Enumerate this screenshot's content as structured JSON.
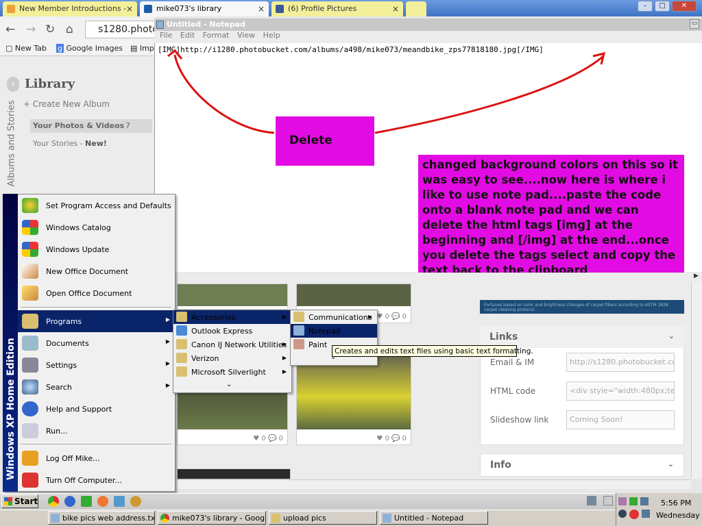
{
  "browser": {
    "tabs": [
      {
        "label": "New Member Introductions -",
        "close": "×"
      },
      {
        "label": "mike073's library",
        "close": "×"
      },
      {
        "label": "(6) Profile Pictures",
        "close": "×"
      }
    ],
    "window_buttons": [
      "–",
      "□",
      "✕"
    ],
    "address": "s1280.photo",
    "bookmarks": [
      "New Tab",
      "Google Images",
      "Imp"
    ]
  },
  "library": {
    "title": "Library",
    "create": "+ Create New Album",
    "photos_videos": "Your Photos & Videos",
    "photos_count": "7",
    "stories": "Your Stories - ",
    "stories_new": "New!",
    "vertical": "Albums and Stories"
  },
  "notepad": {
    "title": "Untitled - Notepad",
    "menu": [
      "File",
      "Edit",
      "Format",
      "View",
      "Help"
    ],
    "content": "[IMG]http://i1280.photobucket.com/albums/a498/mike073/meandbike_zps77818180.jpg[/IMG]",
    "delete_label": "Delete",
    "note": "changed background colors on this so it was easy to see....now here is where i like to use note pad....paste the code onto a blank note pad and we can delete the html tags [img] at the beginning and [/img] at the end...once you delete the tags select and copy the text back to the clipboard",
    "annotation_color": "#e30be3",
    "arrow_color": "#dd1111"
  },
  "photobucket": {
    "blue_strip": "Fortunes based on color and brightness changes of carpet fibers according to ASTM 2828 carpet cleaning protocol.",
    "likes": [
      "0",
      "0"
    ],
    "links_title": "Links",
    "rows": [
      {
        "label": "Email & IM",
        "value": "http://s1280.photobucket.cc"
      },
      {
        "label": "HTML code",
        "value": "<div style=\"width:480px;text-"
      },
      {
        "label": "Slideshow link",
        "value": "Coming Soon!"
      }
    ],
    "info_title": "Info"
  },
  "start_menu": {
    "side_text": "Windows XP Home Edition",
    "items": [
      "Set Program Access and Defaults",
      "Windows Catalog",
      "Windows Update",
      "New Office Document",
      "Open Office Document",
      "Programs",
      "Documents",
      "Settings",
      "Search",
      "Help and Support",
      "Run...",
      "Log Off Mike...",
      "Turn Off Computer..."
    ],
    "programs": [
      "Accessories",
      "Outlook Express",
      "Canon IJ Network Utilities",
      "Verizon",
      "Microsoft Silverlight"
    ],
    "accessories": [
      "Communications",
      "Notepad",
      "Paint"
    ],
    "tooltip": "Creates and edits text files using basic text formatting."
  },
  "taskbar": {
    "start": "Start",
    "tasks": [
      "bike pics web address.tx...",
      "mike073's library - Googl...",
      "upload pics",
      "Untitled - Notepad"
    ],
    "clock": "5:56 PM",
    "day": "Wednesday"
  }
}
